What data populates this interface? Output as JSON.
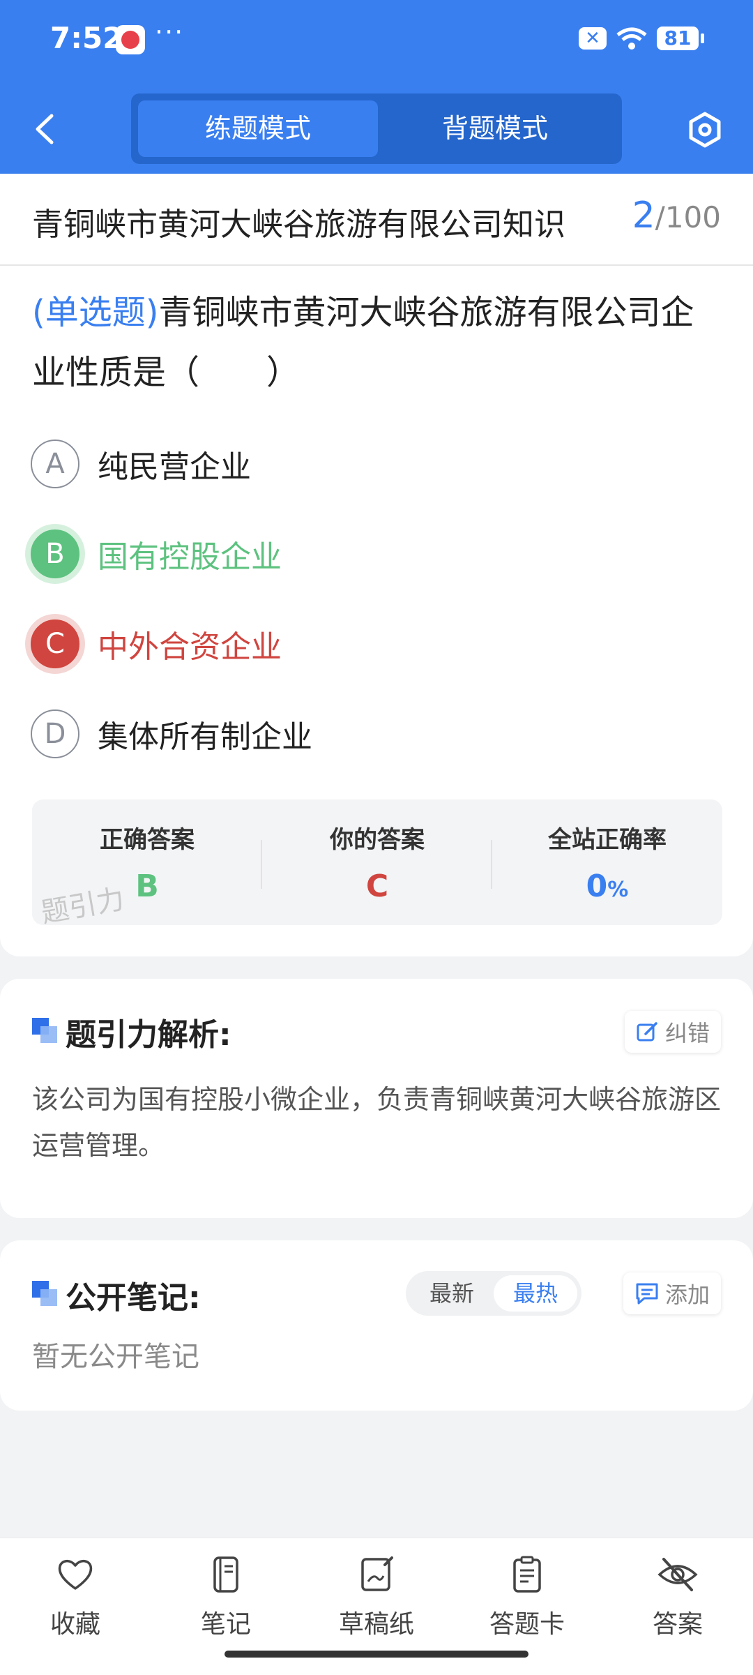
{
  "status_bar": {
    "time": "7:52",
    "dots": "···",
    "battery": "81"
  },
  "header": {
    "tabs": [
      {
        "label": "练题模式"
      },
      {
        "label": "背题模式"
      }
    ]
  },
  "title_bar": {
    "title": "青铜峡市黄河大峡谷旅游有限公司知识",
    "current": "2",
    "separator": "/",
    "total": "100"
  },
  "question": {
    "type": "(单选题)",
    "text": "青铜峡市黄河大峡谷旅游有限公司企业性质是（　　）",
    "options": [
      {
        "letter": "A",
        "text": "纯民营企业"
      },
      {
        "letter": "B",
        "text": "国有控股企业"
      },
      {
        "letter": "C",
        "text": "中外合资企业"
      },
      {
        "letter": "D",
        "text": "集体所有制企业"
      }
    ]
  },
  "answer_summary": {
    "correct_label": "正确答案",
    "correct_value": "B",
    "yours_label": "你的答案",
    "yours_value": "C",
    "rate_label": "全站正确率",
    "rate_value": "0",
    "rate_unit": "%",
    "watermark": "题引力"
  },
  "analysis": {
    "title": "题引力解析:",
    "report_label": "纠错",
    "text": "该公司为国有控股小微企业，负责青铜峡黄河大峡谷旅游区运营管理。"
  },
  "notes": {
    "title": "公开笔记:",
    "sort_latest": "最新",
    "sort_hot": "最热",
    "add_label": "添加",
    "empty_text": "暂无公开笔记"
  },
  "bottom_nav": [
    {
      "label": "收藏"
    },
    {
      "label": "笔记"
    },
    {
      "label": "草稿纸"
    },
    {
      "label": "答题卡"
    },
    {
      "label": "答案"
    }
  ],
  "colors": {
    "primary": "#3a7ff0",
    "correct": "#5dc27f",
    "wrong": "#d0453f"
  }
}
